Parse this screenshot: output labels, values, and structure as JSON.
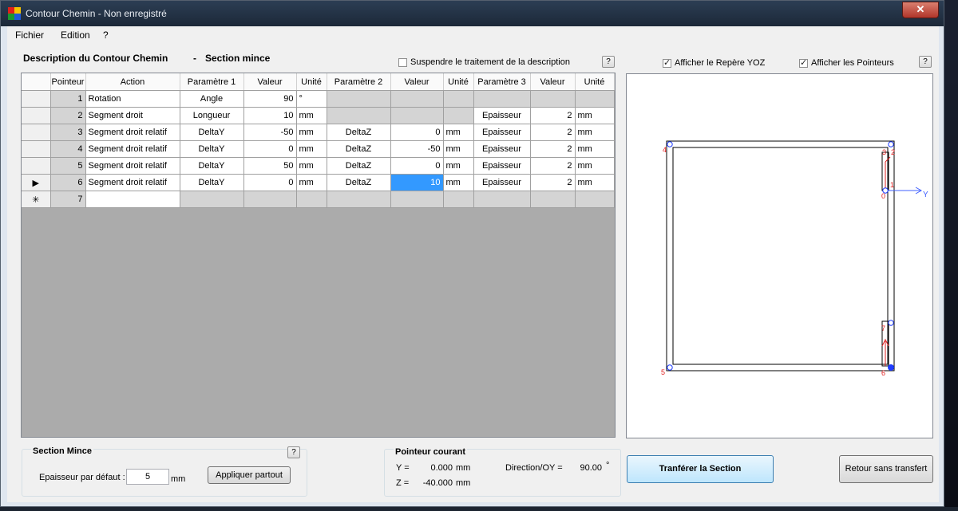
{
  "window": {
    "title": "Contour Chemin - Non enregistré",
    "close_glyph": "✕"
  },
  "menu": [
    "Fichier",
    "Edition",
    "?"
  ],
  "header": {
    "title": "Description du Contour Chemin",
    "dash": "-",
    "section": "Section mince"
  },
  "suspend": {
    "label": "Suspendre le traitement de la description",
    "checked": false
  },
  "help_glyph": "?",
  "show_yoz": {
    "label": "Afficher le Repère YOZ",
    "checked": true
  },
  "show_pointers": {
    "label": "Afficher les Pointeurs",
    "checked": true
  },
  "table": {
    "columns": [
      "Pointeur",
      "Action",
      "Paramètre 1",
      "Valeur",
      "Unité",
      "Paramètre 2",
      "Valeur",
      "Unité",
      "Paramètre 3",
      "Valeur",
      "Unité"
    ],
    "rows": [
      {
        "marker": "",
        "cells": [
          "1",
          "Rotation",
          "Angle",
          "90",
          "°",
          "",
          "",
          "",
          "",
          "",
          ""
        ]
      },
      {
        "marker": "",
        "cells": [
          "2",
          "Segment droit",
          "Longueur",
          "10",
          "mm",
          "",
          "",
          "",
          "Epaisseur",
          "2",
          "mm"
        ]
      },
      {
        "marker": "",
        "cells": [
          "3",
          "Segment droit relatif",
          "DeltaY",
          "-50",
          "mm",
          "DeltaZ",
          "0",
          "mm",
          "Epaisseur",
          "2",
          "mm"
        ]
      },
      {
        "marker": "",
        "cells": [
          "4",
          "Segment droit relatif",
          "DeltaY",
          "0",
          "mm",
          "DeltaZ",
          "-50",
          "mm",
          "Epaisseur",
          "2",
          "mm"
        ]
      },
      {
        "marker": "",
        "cells": [
          "5",
          "Segment droit relatif",
          "DeltaY",
          "50",
          "mm",
          "DeltaZ",
          "0",
          "mm",
          "Epaisseur",
          "2",
          "mm"
        ]
      },
      {
        "marker": "▶",
        "cells": [
          "6",
          "Segment droit relatif",
          "DeltaY",
          "0",
          "mm",
          "DeltaZ",
          "10",
          "mm",
          "Epaisseur",
          "2",
          "mm"
        ]
      },
      {
        "marker": "✳",
        "cells": [
          "7",
          "",
          "",
          "",
          "",
          "",
          "",
          "",
          "",
          "",
          ""
        ]
      }
    ]
  },
  "canvas": {
    "point_labels": [
      "4",
      "3",
      "2",
      "0",
      "1",
      "5",
      "6",
      "7"
    ],
    "axis_label": "Y",
    "colors": {
      "outline": "#000000",
      "pointers": "#e02020",
      "axis": "#4060ff"
    }
  },
  "section_mince": {
    "title": "Section Mince",
    "thickness_label": "Epaisseur par défaut :",
    "thickness_value": "5",
    "unit": "mm",
    "apply_label": "Appliquer partout"
  },
  "pointer": {
    "title": "Pointeur courant",
    "y_label": "Y =",
    "y_value": "0.000",
    "y_unit": "mm",
    "z_label": "Z =",
    "z_value": "-40.000",
    "z_unit": "mm",
    "dir_label": "Direction/OY =",
    "dir_value": "90.00",
    "dir_unit": "°"
  },
  "transfer_label": "Tranférer la Section",
  "cancel_label": "Retour sans transfert"
}
